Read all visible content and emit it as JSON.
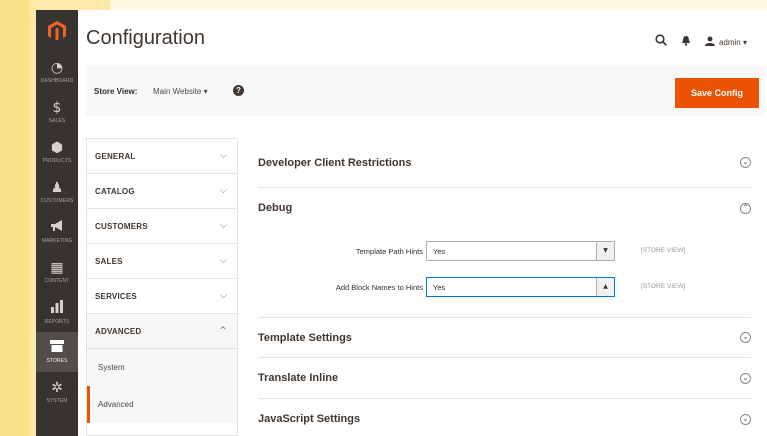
{
  "nav": {
    "logo_icon": "magento-logo-icon",
    "items": [
      {
        "label": "DASHBOARD",
        "icon": "◔",
        "active": false
      },
      {
        "label": "SALES",
        "icon": "$",
        "active": false
      },
      {
        "label": "PRODUCTS",
        "icon": "⬢",
        "active": false
      },
      {
        "label": "CUSTOMERS",
        "icon": "♟",
        "active": false
      },
      {
        "label": "MARKETING",
        "icon": "📢",
        "active": false
      },
      {
        "label": "CONTENT",
        "icon": "▦",
        "active": false
      },
      {
        "label": "REPORTS",
        "icon": "▮",
        "active": false
      },
      {
        "label": "STORES",
        "icon": "▬",
        "active": true
      },
      {
        "label": "SYSTEM",
        "icon": "✲",
        "active": false
      }
    ]
  },
  "header": {
    "title": "Configuration",
    "user": "admin ▾",
    "search_icon": "search-icon",
    "bell_icon": "bell-icon",
    "user_icon": "user-icon"
  },
  "store_bar": {
    "label": "Store View:",
    "value": "Main Website",
    "help_symbol": "?",
    "save_label": "Save Config",
    "accent": "#eb5202"
  },
  "tabs": [
    {
      "label": "GENERAL",
      "chev": "⌵"
    },
    {
      "label": "CATALOG",
      "chev": "⌵"
    },
    {
      "label": "CUSTOMERS",
      "chev": "⌵"
    },
    {
      "label": "SALES",
      "chev": "⌵"
    },
    {
      "label": "SERVICES",
      "chev": "⌵"
    },
    {
      "label": "ADVANCED",
      "chev": "^"
    }
  ],
  "subitems": [
    "System",
    "Advanced"
  ],
  "sections": {
    "dev_client": "Developer Client Restrictions",
    "debug": "Debug",
    "template_settings": "Template Settings",
    "translate_inline": "Translate Inline",
    "js_settings": "JavaScript Settings"
  },
  "debug_fields": {
    "template_hints_label": "Template Path Hints",
    "template_hints_value": "Yes",
    "block_names_label": "Add Block Names to Hints",
    "block_names_value": "Yes",
    "scope": "[STORE VIEW]"
  }
}
